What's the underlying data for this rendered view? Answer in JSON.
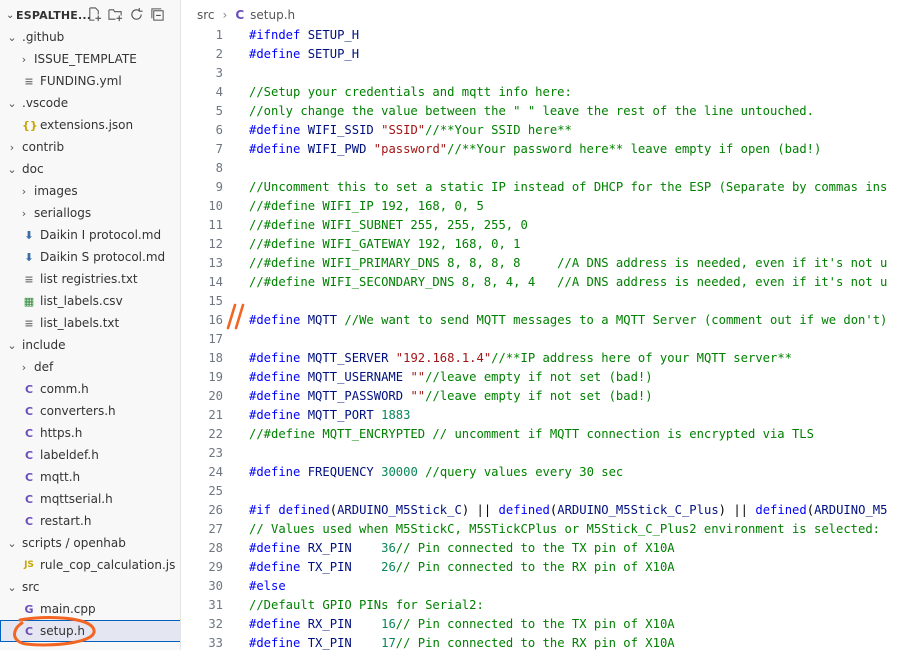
{
  "explorer": {
    "title": "ESPALTHE...",
    "items": [
      {
        "label": ".github",
        "type": "folder",
        "indent": 1,
        "open": true
      },
      {
        "label": "ISSUE_TEMPLATE",
        "type": "folder",
        "indent": 2,
        "open": false
      },
      {
        "label": "FUNDING.yml",
        "type": "txt",
        "indent": 2
      },
      {
        "label": ".vscode",
        "type": "folder",
        "indent": 1,
        "open": true
      },
      {
        "label": "extensions.json",
        "type": "json",
        "indent": 2
      },
      {
        "label": "contrib",
        "type": "folder",
        "indent": 1,
        "open": false
      },
      {
        "label": "doc",
        "type": "folder",
        "indent": 1,
        "open": true
      },
      {
        "label": "images",
        "type": "folder",
        "indent": 2,
        "open": false
      },
      {
        "label": "seriallogs",
        "type": "folder",
        "indent": 2,
        "open": false
      },
      {
        "label": "Daikin I protocol.md",
        "type": "md",
        "indent": 2
      },
      {
        "label": "Daikin S protocol.md",
        "type": "md",
        "indent": 2
      },
      {
        "label": "list registries.txt",
        "type": "txt",
        "indent": 2
      },
      {
        "label": "list_labels.csv",
        "type": "csv",
        "indent": 2
      },
      {
        "label": "list_labels.txt",
        "type": "txt",
        "indent": 2
      },
      {
        "label": "include",
        "type": "folder",
        "indent": 1,
        "open": true
      },
      {
        "label": "def",
        "type": "folder",
        "indent": 2,
        "open": false
      },
      {
        "label": "comm.h",
        "type": "c",
        "indent": 2
      },
      {
        "label": "converters.h",
        "type": "c",
        "indent": 2
      },
      {
        "label": "https.h",
        "type": "c",
        "indent": 2
      },
      {
        "label": "labeldef.h",
        "type": "c",
        "indent": 2
      },
      {
        "label": "mqtt.h",
        "type": "c",
        "indent": 2
      },
      {
        "label": "mqttserial.h",
        "type": "c",
        "indent": 2
      },
      {
        "label": "restart.h",
        "type": "c",
        "indent": 2
      },
      {
        "label": "scripts / openhab",
        "type": "folder",
        "indent": 1,
        "open": true
      },
      {
        "label": "rule_cop_calculation.js",
        "type": "js",
        "indent": 2
      },
      {
        "label": "src",
        "type": "folder",
        "indent": 1,
        "open": true
      },
      {
        "label": "main.cpp",
        "type": "cpp",
        "indent": 2
      },
      {
        "label": "setup.h",
        "type": "c",
        "indent": 2,
        "selected": true
      }
    ]
  },
  "icons": {
    "c": "C",
    "cpp": "G",
    "json": "{}",
    "js": "JS",
    "md": "⬇",
    "csv": "▦",
    "txt": "≡"
  },
  "breadcrumb": {
    "folder": "src",
    "file": "setup.h"
  },
  "code": [
    [
      [
        "kw",
        "#ifndef"
      ],
      [
        "t",
        " "
      ],
      [
        "id",
        "SETUP_H"
      ]
    ],
    [
      [
        "kw",
        "#define"
      ],
      [
        "t",
        " "
      ],
      [
        "id",
        "SETUP_H"
      ]
    ],
    [],
    [
      [
        "com",
        "//Setup your credentials and mqtt info here:"
      ]
    ],
    [
      [
        "com",
        "//only change the value between the \" \" leave the rest of the line untouched."
      ]
    ],
    [
      [
        "kw",
        "#define"
      ],
      [
        "t",
        " "
      ],
      [
        "id",
        "WIFI_SSID"
      ],
      [
        "t",
        " "
      ],
      [
        "str",
        "\"SSID\""
      ],
      [
        "com",
        "//**Your SSID here**"
      ]
    ],
    [
      [
        "kw",
        "#define"
      ],
      [
        "t",
        " "
      ],
      [
        "id",
        "WIFI_PWD"
      ],
      [
        "t",
        " "
      ],
      [
        "str",
        "\"password\""
      ],
      [
        "com",
        "//**Your password here** leave empty if open (bad!)"
      ]
    ],
    [],
    [
      [
        "com",
        "//Uncomment this to set a static IP instead of DHCP for the ESP (Separate by commas ins"
      ]
    ],
    [
      [
        "com",
        "//#define WIFI_IP 192, 168, 0, 5"
      ]
    ],
    [
      [
        "com",
        "//#define WIFI_SUBNET 255, 255, 255, 0"
      ]
    ],
    [
      [
        "com",
        "//#define WIFI_GATEWAY 192, 168, 0, 1"
      ]
    ],
    [
      [
        "com",
        "//#define WIFI_PRIMARY_DNS 8, 8, 8, 8     //A DNS address is needed, even if it's not u"
      ]
    ],
    [
      [
        "com",
        "//#define WIFI_SECONDARY_DNS 8, 8, 4, 4   //A DNS address is needed, even if it's not u"
      ]
    ],
    [],
    [
      [
        "kw",
        "#define"
      ],
      [
        "t",
        " "
      ],
      [
        "id",
        "MQTT"
      ],
      [
        "t",
        " "
      ],
      [
        "com",
        "//We want to send MQTT messages to a MQTT Server (comment out if we don't)"
      ]
    ],
    [],
    [
      [
        "kw",
        "#define"
      ],
      [
        "t",
        " "
      ],
      [
        "id",
        "MQTT_SERVER"
      ],
      [
        "t",
        " "
      ],
      [
        "str",
        "\"192.168.1.4\""
      ],
      [
        "com",
        "//**IP address here of your MQTT server**"
      ]
    ],
    [
      [
        "kw",
        "#define"
      ],
      [
        "t",
        " "
      ],
      [
        "id",
        "MQTT_USERNAME"
      ],
      [
        "t",
        " "
      ],
      [
        "str",
        "\"\""
      ],
      [
        "com",
        "//leave empty if not set (bad!)"
      ]
    ],
    [
      [
        "kw",
        "#define"
      ],
      [
        "t",
        " "
      ],
      [
        "id",
        "MQTT_PASSWORD"
      ],
      [
        "t",
        " "
      ],
      [
        "str",
        "\"\""
      ],
      [
        "com",
        "//leave empty if not set (bad!)"
      ]
    ],
    [
      [
        "kw",
        "#define"
      ],
      [
        "t",
        " "
      ],
      [
        "id",
        "MQTT_PORT"
      ],
      [
        "t",
        " "
      ],
      [
        "num",
        "1883"
      ]
    ],
    [
      [
        "com",
        "//#define MQTT_ENCRYPTED // uncomment if MQTT connection is encrypted via TLS"
      ]
    ],
    [],
    [
      [
        "kw",
        "#define"
      ],
      [
        "t",
        " "
      ],
      [
        "id",
        "FREQUENCY"
      ],
      [
        "t",
        " "
      ],
      [
        "num",
        "30000"
      ],
      [
        "t",
        " "
      ],
      [
        "com",
        "//query values every 30 sec"
      ]
    ],
    [],
    [
      [
        "kw",
        "#if"
      ],
      [
        "t",
        " "
      ],
      [
        "kw",
        "defined"
      ],
      [
        "t",
        "("
      ],
      [
        "id",
        "ARDUINO_M5Stick_C"
      ],
      [
        "t",
        ") || "
      ],
      [
        "kw",
        "defined"
      ],
      [
        "t",
        "("
      ],
      [
        "id",
        "ARDUINO_M5Stick_C_Plus"
      ],
      [
        "t",
        ") || "
      ],
      [
        "kw",
        "defined"
      ],
      [
        "t",
        "("
      ],
      [
        "id",
        "ARDUINO_M5"
      ]
    ],
    [
      [
        "com",
        "// Values used when M5StickC, M5STickCPlus or M5Stick_C_Plus2 environment is selected:"
      ]
    ],
    [
      [
        "kw",
        "#define"
      ],
      [
        "t",
        " "
      ],
      [
        "id",
        "RX_PIN"
      ],
      [
        "t",
        "    "
      ],
      [
        "num",
        "36"
      ],
      [
        "com",
        "// Pin connected to the TX pin of X10A"
      ]
    ],
    [
      [
        "kw",
        "#define"
      ],
      [
        "t",
        " "
      ],
      [
        "id",
        "TX_PIN"
      ],
      [
        "t",
        "    "
      ],
      [
        "num",
        "26"
      ],
      [
        "com",
        "// Pin connected to the RX pin of X10A"
      ]
    ],
    [
      [
        "kw",
        "#else"
      ]
    ],
    [
      [
        "com",
        "//Default GPIO PINs for Serial2:"
      ]
    ],
    [
      [
        "kw",
        "#define"
      ],
      [
        "t",
        " "
      ],
      [
        "id",
        "RX_PIN"
      ],
      [
        "t",
        "    "
      ],
      [
        "num",
        "16"
      ],
      [
        "com",
        "// Pin connected to the TX pin of X10A"
      ]
    ],
    [
      [
        "kw",
        "#define"
      ],
      [
        "t",
        " "
      ],
      [
        "id",
        "TX_PIN"
      ],
      [
        "t",
        "    "
      ],
      [
        "num",
        "17"
      ],
      [
        "com",
        "// Pin connected to the RX pin of X10A"
      ]
    ]
  ]
}
